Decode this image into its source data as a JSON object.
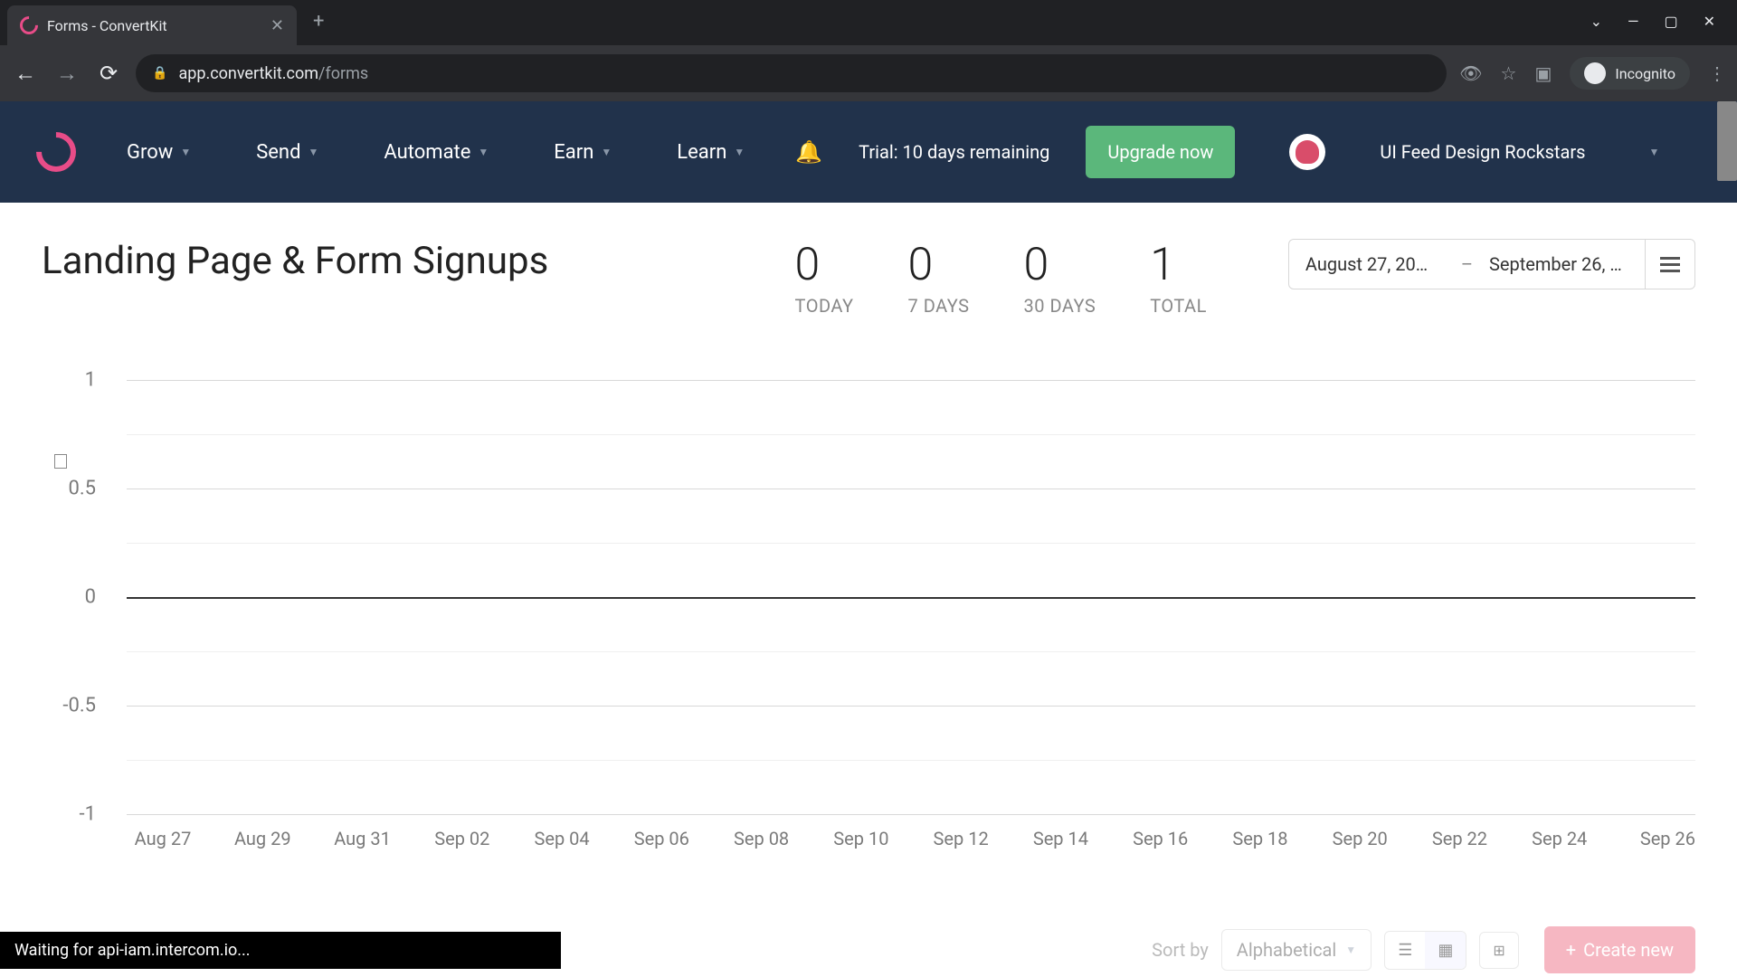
{
  "browser": {
    "tab_title": "Forms - ConvertKit",
    "url_domain": "app.convertkit.com",
    "url_path": "/forms",
    "incognito_label": "Incognito"
  },
  "nav": {
    "items": [
      "Grow",
      "Send",
      "Automate",
      "Earn",
      "Learn"
    ],
    "trial_text": "Trial: 10 days remaining",
    "upgrade_label": "Upgrade now",
    "account_name": "UI Feed Design Rockstars"
  },
  "page": {
    "title": "Landing Page & Form Signups",
    "stats": [
      {
        "value": "0",
        "label": "TODAY"
      },
      {
        "value": "0",
        "label": "7 DAYS"
      },
      {
        "value": "0",
        "label": "30 DAYS"
      },
      {
        "value": "1",
        "label": "TOTAL"
      }
    ],
    "date_start": "August 27, 20…",
    "date_end": "September 26, 20…"
  },
  "chart_data": {
    "type": "line",
    "title": "",
    "xlabel": "",
    "ylabel": "",
    "ylim": [
      -1,
      1
    ],
    "y_ticks": [
      "1",
      "0.5",
      "0",
      "-0.5",
      "-1"
    ],
    "categories": [
      "Aug 27",
      "Aug 29",
      "Aug 31",
      "Sep 02",
      "Sep 04",
      "Sep 06",
      "Sep 08",
      "Sep 10",
      "Sep 12",
      "Sep 14",
      "Sep 16",
      "Sep 18",
      "Sep 20",
      "Sep 22",
      "Sep 24",
      "Sep 26"
    ],
    "values": [
      0,
      0,
      0,
      0,
      0,
      0,
      0,
      0,
      0,
      0,
      0,
      0,
      0,
      0,
      0,
      0
    ]
  },
  "bottom": {
    "status_text": "Waiting for api-iam.intercom.io...",
    "sort_label": "Sort by",
    "sort_value": "Alphabetical",
    "create_label": "Create new"
  }
}
